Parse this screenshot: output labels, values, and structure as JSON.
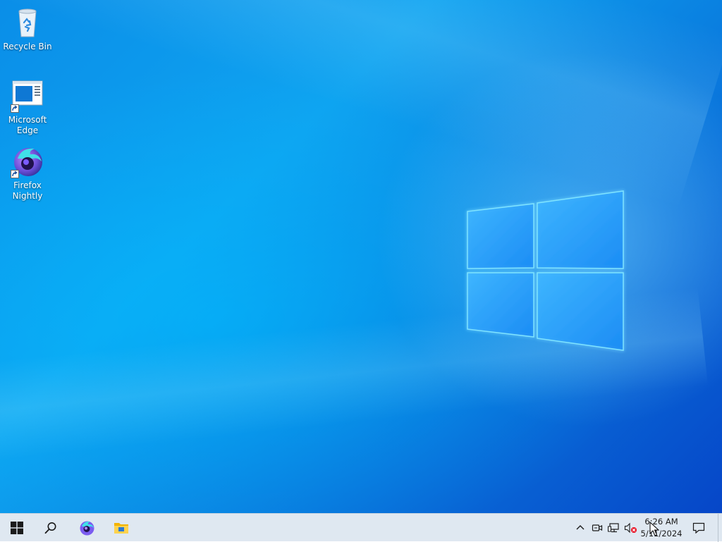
{
  "desktop": {
    "icons": [
      {
        "label": "Recycle Bin",
        "icon": "recycle-bin-icon"
      },
      {
        "label": "Microsoft Edge",
        "icon": "edge-shortcut-icon"
      },
      {
        "label": "Firefox Nightly",
        "icon": "firefox-nightly-icon"
      }
    ]
  },
  "taskbar": {
    "start_icon": "windows-logo-icon",
    "search_icon": "search-icon",
    "pinned": [
      {
        "name": "Firefox Nightly",
        "icon": "firefox-nightly-icon"
      },
      {
        "name": "File Explorer",
        "icon": "folder-icon"
      }
    ],
    "tray": {
      "overflow_icon": "chevron-up-icon",
      "icons": [
        "meet-now-icon",
        "network-icon",
        "volume-muted-icon"
      ],
      "clock": {
        "time": "6:26 AM",
        "date": "5/11/2024"
      },
      "notifications_icon": "action-center-icon"
    }
  },
  "colors": {
    "wallpaper_primary": "#0a8ee8",
    "wallpaper_dark": "#0646c8",
    "taskbar_bg": "#dfe8f1",
    "logo_glow": "#4fd0ff"
  }
}
